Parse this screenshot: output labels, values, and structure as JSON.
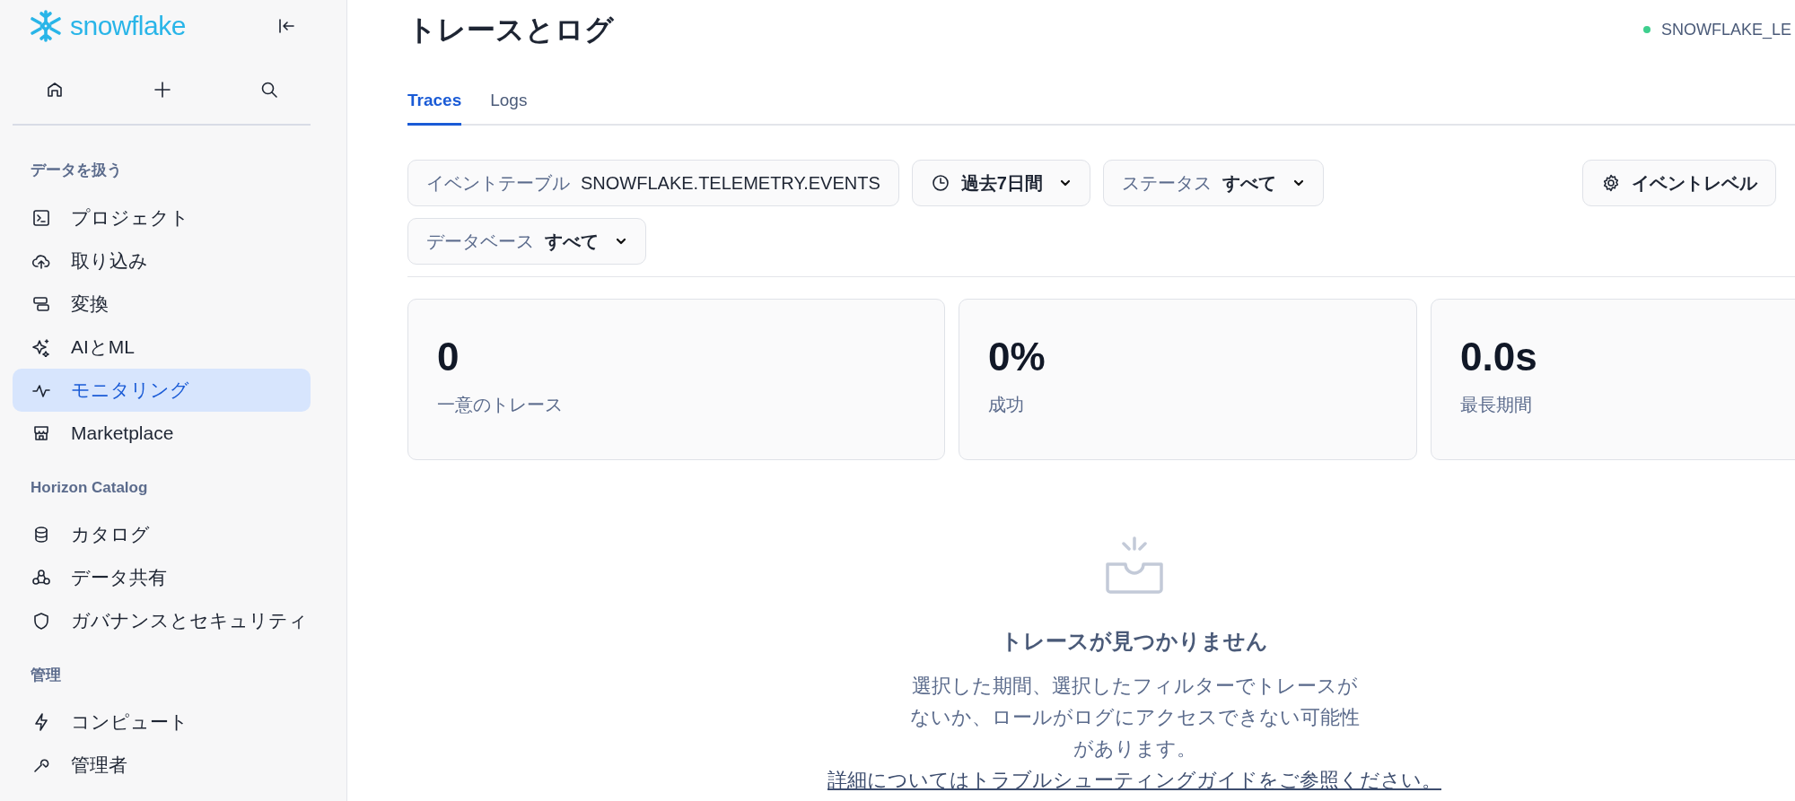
{
  "sidebar": {
    "logo_text": "snowflake",
    "sections": [
      {
        "heading": "データを扱う",
        "items": [
          {
            "label": "プロジェクト",
            "selected": false
          },
          {
            "label": "取り込み",
            "selected": false
          },
          {
            "label": "変換",
            "selected": false
          },
          {
            "label": "AIとML",
            "selected": false
          },
          {
            "label": "モニタリング",
            "selected": true
          },
          {
            "label": "Marketplace",
            "selected": false
          }
        ]
      },
      {
        "heading": "Horizon Catalog",
        "items": [
          {
            "label": "カタログ",
            "selected": false
          },
          {
            "label": "データ共有",
            "selected": false
          },
          {
            "label": "ガバナンスとセキュリティ",
            "selected": false
          }
        ]
      },
      {
        "heading": "管理",
        "items": [
          {
            "label": "コンピュート",
            "selected": false
          },
          {
            "label": "管理者",
            "selected": false
          }
        ]
      }
    ]
  },
  "page": {
    "title": "トレースとログ",
    "account": "SNOWFLAKE_LE"
  },
  "tabs": [
    {
      "label": "Traces",
      "selected": true
    },
    {
      "label": "Logs",
      "selected": false
    }
  ],
  "filter_rows": [
    {
      "filters": [
        {
          "kind": "static",
          "label": "イベントテーブル",
          "value": "SNOWFLAKE.TELEMETRY.EVENTS"
        },
        {
          "kind": "time",
          "value": "過去7日間"
        },
        {
          "kind": "dropdown",
          "label": "ステータス",
          "value": "すべて"
        }
      ]
    },
    {
      "filters": [
        {
          "kind": "dropdown",
          "label": "データベース",
          "value": "すべて"
        }
      ]
    }
  ],
  "event_level_button": {
    "label": "イベントレベル"
  },
  "stats": [
    {
      "value": "0",
      "label": "一意のトレース"
    },
    {
      "value": "0%",
      "label": "成功"
    },
    {
      "value": "0.0s",
      "label": "最長期間"
    }
  ],
  "empty_state": {
    "title": "トレースが見つかりません",
    "message": "選択した期間、選択したフィルターでトレースがないか、ロールがログにアクセスできない可能性があります。",
    "link": "詳細についてはトラブルシューティングガイドをご参照ください。"
  }
}
